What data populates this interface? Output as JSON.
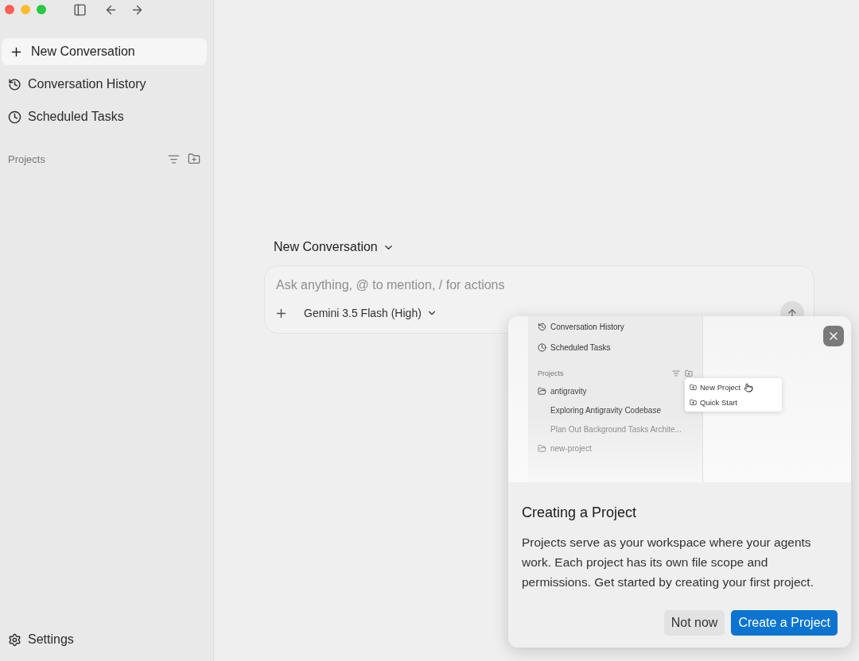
{
  "sidebar": {
    "new_button": "New Conversation",
    "items": [
      {
        "kind": "history",
        "label": "Conversation History"
      },
      {
        "kind": "clock",
        "label": "Scheduled Tasks"
      }
    ],
    "projects_label": "Projects",
    "settings": "Settings"
  },
  "main": {
    "title": "New Conversation",
    "composer": {
      "placeholder": "Ask anything, @ to mention, / for actions",
      "model": "Gemini 3.5 Flash (High)"
    }
  },
  "popover": {
    "preview": {
      "items": [
        {
          "kind": "history",
          "label": "Conversation History"
        },
        {
          "kind": "clock",
          "label": "Scheduled Tasks"
        }
      ],
      "projects_label": "Projects",
      "tree": [
        {
          "kind": "folder",
          "label": "antigravity",
          "faded": false
        },
        {
          "kind": "chat",
          "label": "Exploring Antigravity Codebase",
          "faded": false
        },
        {
          "kind": "chat",
          "label": "Plan Out Background Tasks Archite...",
          "faded": true
        },
        {
          "kind": "folder",
          "label": "new-project",
          "faded": true
        }
      ],
      "menu": [
        "New Project",
        "Quick Start"
      ]
    },
    "title": "Creating a Project",
    "body": "Projects serve as your workspace where your agents work. Each project has its own file scope and permissions. Get started by creating your first project.",
    "buttons": [
      {
        "kind": "secondary",
        "label": "Not now"
      },
      {
        "kind": "primary",
        "label": "Create a Project"
      }
    ]
  }
}
